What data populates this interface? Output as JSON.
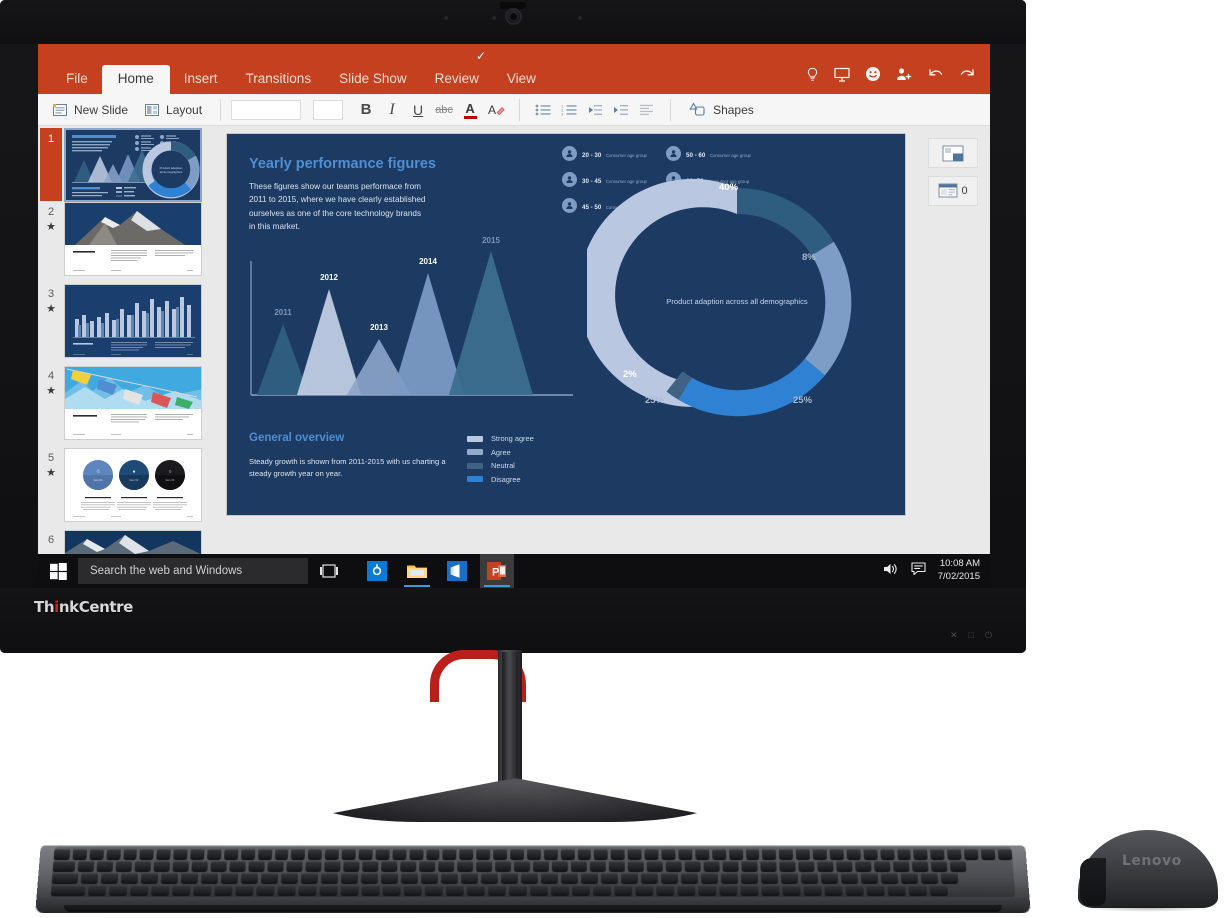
{
  "device": {
    "brand_logo": "ThinkCentre",
    "brand_logo_prefix": "Th",
    "brand_logo_dot": "i",
    "brand_logo_suffix": "nkCentre",
    "mouse_logo": "Lenovo",
    "bezel_buttons": [
      "✕",
      "□",
      "⏻"
    ]
  },
  "app": {
    "ribbon": {
      "autosave_check": "✓",
      "tabs": [
        {
          "label": "File",
          "active": false
        },
        {
          "label": "Home",
          "active": true
        },
        {
          "label": "Insert",
          "active": false
        },
        {
          "label": "Transitions",
          "active": false
        },
        {
          "label": "Slide Show",
          "active": false
        },
        {
          "label": "Review",
          "active": false
        },
        {
          "label": "View",
          "active": false
        }
      ],
      "right_icons": [
        "tell-me-icon",
        "present-icon",
        "smiley-icon",
        "share-icon",
        "undo-icon",
        "redo-icon"
      ],
      "accent_color": "#c4401f"
    },
    "toolbar": {
      "new_slide_label": "New Slide",
      "layout_label": "Layout",
      "font_name_value": "",
      "font_name_placeholder": "",
      "font_size_value": "",
      "font_size_placeholder": "",
      "bold_label": "B",
      "italic_label": "I",
      "underline_label": "U",
      "strikethrough_label": "abc",
      "font_color_label": "A",
      "clear_format_label": "A",
      "shapes_label": "Shapes",
      "list_icons": [
        "bullets-icon",
        "numbering-icon",
        "decrease-indent-icon",
        "increase-indent-icon",
        "align-left-icon"
      ]
    },
    "thumbnails": [
      {
        "number": "1",
        "starred": false,
        "selected": true,
        "kind": "chart-slide"
      },
      {
        "number": "2",
        "starred": true,
        "selected": false,
        "kind": "photo-mountain"
      },
      {
        "number": "3",
        "starred": true,
        "selected": false,
        "kind": "bar-chart"
      },
      {
        "number": "4",
        "starred": true,
        "selected": false,
        "kind": "photo-flags"
      },
      {
        "number": "5",
        "starred": true,
        "selected": false,
        "kind": "three-circles"
      },
      {
        "number": "6",
        "starred": false,
        "selected": false,
        "kind": "photo-ridge"
      }
    ],
    "right_panel": {
      "notes_button": "notes-pane-icon",
      "comments_button": "comments-pane-icon",
      "comments_count": "0"
    }
  },
  "slide": {
    "background_color": "#1d3a63",
    "title": "Yearly performance figures",
    "body": "These figures show our teams performace from 2011 to 2015, where we have clearly established ourselves as one of the core technology brands in this market.",
    "age_groups": [
      {
        "range": "20 - 30",
        "caption": "Consumer age group"
      },
      {
        "range": "50 - 60",
        "caption": "Consumer age group"
      },
      {
        "range": "30 - 45",
        "caption": "Consumer age group"
      },
      {
        "range": "60- 70",
        "caption": "Consumer age group"
      },
      {
        "range": "45 - 50",
        "caption": "Consumer age group"
      }
    ],
    "overview_title": "General overview",
    "overview_body": "Steady growth is shown from 2011-2015 with us charting a steady growth year on year.",
    "legend": [
      {
        "label": "Strong agree",
        "color": "#b9c8e0"
      },
      {
        "label": "Agree",
        "color": "#94aacb"
      },
      {
        "label": "Neutral",
        "color": "#3f6285"
      },
      {
        "label": "Disagree",
        "color": "#2f81d4"
      }
    ]
  },
  "chart_data": [
    {
      "type": "area",
      "title": "Yearly performance figures",
      "categories": [
        "2011",
        "2012",
        "2013",
        "2014",
        "2015"
      ],
      "values": [
        38,
        72,
        44,
        85,
        100
      ],
      "xlabel": "",
      "ylabel": "",
      "ylim": [
        0,
        100
      ],
      "grid": false,
      "legend_position": "bottom-right",
      "series_colors": [
        "#2f5d7f",
        "#c3d0e6",
        "#8da5c9",
        "#7d9cc6",
        "#3d6e8e"
      ],
      "annotations": [
        "2011",
        "2012",
        "2013",
        "2014",
        "2015"
      ]
    },
    {
      "type": "pie",
      "title": "Product adaption across all demographics",
      "center_label": "Product adaption across all demographics",
      "categories": [
        "40%",
        "8%",
        "25%",
        "25%",
        "2%"
      ],
      "values": [
        40,
        8,
        25,
        25,
        2
      ],
      "slice_colors": [
        "#b9c8e0",
        "#2f5d7f",
        "#7d9cc6",
        "#2f81d4",
        "#3f6285"
      ],
      "labels": [
        "40%",
        "8%",
        "25%",
        "25%",
        "2%"
      ],
      "legend_position": "none",
      "donut": true
    }
  ],
  "taskbar": {
    "start_label": "start-button",
    "search_placeholder": "Search the web and Windows",
    "search_value": "",
    "task_view_label": "task-view-icon",
    "apps": [
      {
        "name": "store-icon",
        "label": "⚙",
        "open": false,
        "active": false
      },
      {
        "name": "file-explorer-icon",
        "label": "",
        "open": true,
        "active": false
      },
      {
        "name": "office-icon",
        "label": "",
        "open": false,
        "active": false
      },
      {
        "name": "powerpoint-icon",
        "label": "P",
        "open": true,
        "active": true
      }
    ],
    "tray": {
      "volume_icon": "volume-icon",
      "action_center_icon": "action-center-icon",
      "time": "10:08 AM",
      "date": "7/02/2015"
    }
  }
}
